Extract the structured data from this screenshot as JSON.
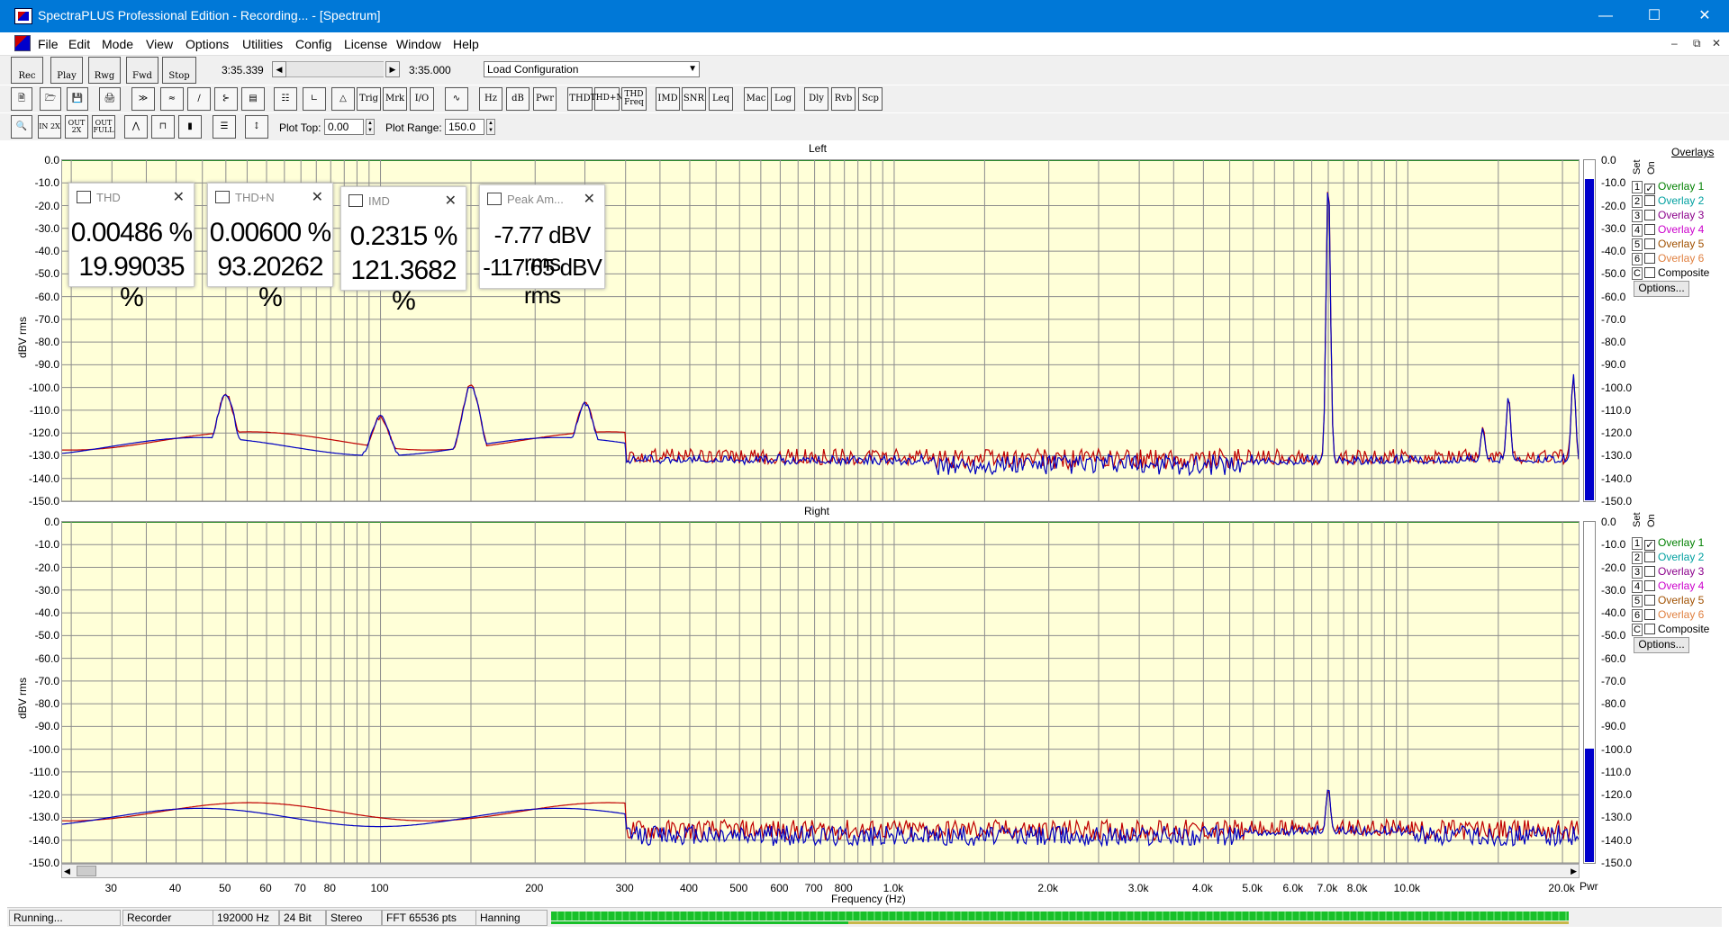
{
  "window": {
    "title": "SpectraPLUS Professional Edition - Recording... - [Spectrum]"
  },
  "menu": [
    "File",
    "Edit",
    "Mode",
    "View",
    "Options",
    "Utilities",
    "Config",
    "License",
    "Window",
    "Help"
  ],
  "transport": {
    "buttons": [
      "Rec",
      "Play",
      "Rwg",
      "Fwd",
      "Stop"
    ],
    "time_left": "3:35.339",
    "time_right": "3:35.000",
    "config_select": "Load Configuration"
  },
  "toolbar2": {
    "text_buttons": [
      "Trig",
      "Mrk",
      "I/O",
      "Hz",
      "dB",
      "Pwr",
      "THD",
      "THD+N",
      "THD Freq",
      "IMD",
      "SNR",
      "Leq",
      "Mac",
      "Log",
      "Dly",
      "Rvb",
      "Scp"
    ]
  },
  "toolbar3": {
    "plot_top_label": "Plot Top:",
    "plot_top_value": "0.00",
    "plot_range_label": "Plot Range:",
    "plot_range_value": "150.0"
  },
  "measurements": [
    {
      "name": "THD",
      "line1": "0.00486 %",
      "line2": "19.99035 %"
    },
    {
      "name": "THD+N",
      "line1": "0.00600 %",
      "line2": "93.20262 %"
    },
    {
      "name": "IMD",
      "line1": "0.2315 %",
      "line2": "121.3682 %"
    },
    {
      "name": "Peak Am...",
      "line1": "-7.77 dBV rms",
      "line2": "-117.65 dBV rms"
    }
  ],
  "panes": [
    {
      "title": "Left",
      "ylabel": "dBV rms",
      "meter_level_dbv": -7.77
    },
    {
      "title": "Right",
      "ylabel": "dBV rms",
      "meter_level_dbv": -100
    }
  ],
  "y_ticks": [
    "0.0",
    "-10.0",
    "-20.0",
    "-30.0",
    "-40.0",
    "-50.0",
    "-60.0",
    "-70.0",
    "-80.0",
    "-90.0",
    "-100.0",
    "-110.0",
    "-120.0",
    "-130.0",
    "-140.0",
    "-150.0"
  ],
  "x_ticks": [
    "30",
    "40",
    "50",
    "60",
    "70",
    "80",
    "100",
    "200",
    "300",
    "400",
    "500",
    "600",
    "700",
    "800",
    "1.0k",
    "2.0k",
    "3.0k",
    "4.0k",
    "5.0k",
    "6.0k",
    "7.0k",
    "8.0k",
    "10.0k",
    "20.0k"
  ],
  "x_label": "Frequency (Hz)",
  "meter_label": "Pwr",
  "overlays": {
    "title": "Overlays",
    "set_label": "Set",
    "on_label": "On",
    "items": [
      {
        "num": "1",
        "label": "Overlay 1",
        "color": "#008000",
        "checked": true
      },
      {
        "num": "2",
        "label": "Overlay 2",
        "color": "#00a0a0",
        "checked": false
      },
      {
        "num": "3",
        "label": "Overlay 3",
        "color": "#8b008b",
        "checked": false
      },
      {
        "num": "4",
        "label": "Overlay 4",
        "color": "#cc00cc",
        "checked": false
      },
      {
        "num": "5",
        "label": "Overlay 5",
        "color": "#a05000",
        "checked": false
      },
      {
        "num": "6",
        "label": "Overlay 6",
        "color": "#e08040",
        "checked": false
      },
      {
        "num": "C",
        "label": "Composite",
        "color": "#000000",
        "checked": false
      }
    ],
    "options_button": "Options..."
  },
  "status": [
    "Running...",
    "Recorder",
    "192000 Hz",
    "24 Bit",
    "Stereo",
    "FFT 65536 pts",
    "Hanning"
  ],
  "chart_data": {
    "type": "line",
    "x_scale": "log",
    "xlim": [
      24,
      21500
    ],
    "ylim": [
      -150,
      0
    ],
    "xlabel": "Frequency (Hz)",
    "ylabel": "dBV rms",
    "colors": {
      "ch1": "#c00000",
      "ch2": "#0000c0"
    },
    "left_peaks": [
      {
        "hz": 50,
        "db": -103
      },
      {
        "hz": 100,
        "db": -113
      },
      {
        "hz": 150,
        "db": -99
      },
      {
        "hz": 250,
        "db": -107
      },
      {
        "hz": 7000,
        "db": -8
      },
      {
        "hz": 14000,
        "db": -118
      },
      {
        "hz": 15700,
        "db": -104
      },
      {
        "hz": 21000,
        "db": -95
      }
    ],
    "left_floor_db": -133,
    "right_peaks": [
      {
        "hz": 7000,
        "db": -117
      }
    ],
    "right_floor_db": -137
  }
}
